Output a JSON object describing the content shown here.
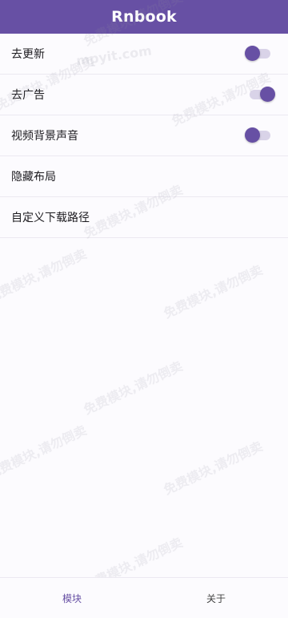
{
  "header": {
    "title": "Rnbook"
  },
  "settings": [
    {
      "label": "去更新",
      "toggle": "off"
    },
    {
      "label": "去广告",
      "toggle": "on"
    },
    {
      "label": "视频背景声音",
      "toggle": "off"
    },
    {
      "label": "隐藏布局",
      "toggle": null
    },
    {
      "label": "自定义下载路径",
      "toggle": null
    }
  ],
  "watermark": {
    "text": "免费模块,请勿倒卖",
    "site": "mpyit.com"
  },
  "bottom_nav": {
    "tab_modules": "模块",
    "tab_about": "关于"
  },
  "colors": {
    "accent": "#6750a4",
    "background": "#fcfbfe"
  }
}
